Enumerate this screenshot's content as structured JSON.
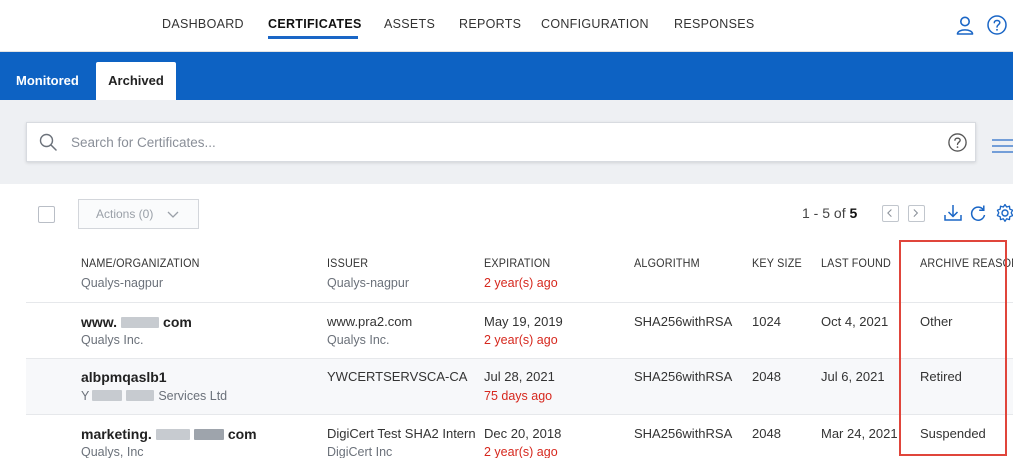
{
  "nav": {
    "items": [
      "DASHBOARD",
      "CERTIFICATES",
      "ASSETS",
      "REPORTS",
      "CONFIGURATION",
      "RESPONSES"
    ],
    "active": "CERTIFICATES",
    "user_icon": "user-icon",
    "help_icon": "help-icon"
  },
  "tabs": [
    "Monitored",
    "Archived"
  ],
  "active_tab": "Archived",
  "search": {
    "placeholder": "Search for Certificates...",
    "value": ""
  },
  "actions": {
    "label": "Actions (0)"
  },
  "pager": {
    "range": "1 - 5 of",
    "total": "5"
  },
  "table": {
    "headers": [
      "NAME/ORGANIZATION",
      "ISSUER",
      "EXPIRATION",
      "ALGORITHM",
      "KEY SIZE",
      "LAST FOUND",
      "ARCHIVE REASON"
    ],
    "partial_row": {
      "organization": "Qualys-nagpur",
      "issuer": "Qualys-nagpur",
      "expiration_relative": "2 year(s) ago"
    },
    "rows": [
      {
        "name_prefix": "www.",
        "name_suffix": "com",
        "organization": "Qualys Inc.",
        "issuer": "www.pra2.com",
        "issuer_org": "Qualys Inc.",
        "expiration": "May 19, 2019",
        "expiration_relative": "2 year(s) ago",
        "algorithm": "SHA256withRSA",
        "key_size": "1024",
        "last_found": "Oct 4, 2021",
        "archive_reason": "Other"
      },
      {
        "name": "albpmqaslb1",
        "org_prefix": "Y",
        "org_suffix": "Services Ltd",
        "issuer": "YWCERTSERVSCA-CA",
        "issuer_org": "",
        "expiration": "Jul 28, 2021",
        "expiration_relative": "75 days ago",
        "algorithm": "SHA256withRSA",
        "key_size": "2048",
        "last_found": "Jul 6, 2021",
        "archive_reason": "Retired"
      },
      {
        "name_prefix": "marketing.",
        "name_suffix": "com",
        "organization": "Qualys, Inc",
        "issuer": "DigiCert Test SHA2 Intern",
        "issuer_org": "DigiCert Inc",
        "expiration": "Dec 20, 2018",
        "expiration_relative": "2 year(s) ago",
        "algorithm": "SHA256withRSA",
        "key_size": "2048",
        "last_found": "Mar 24, 2021",
        "archive_reason": "Suspended"
      }
    ]
  },
  "colors": {
    "brand_blue": "#0d62c3",
    "expired_red": "#d6281e",
    "highlight_red": "#e0453b"
  }
}
